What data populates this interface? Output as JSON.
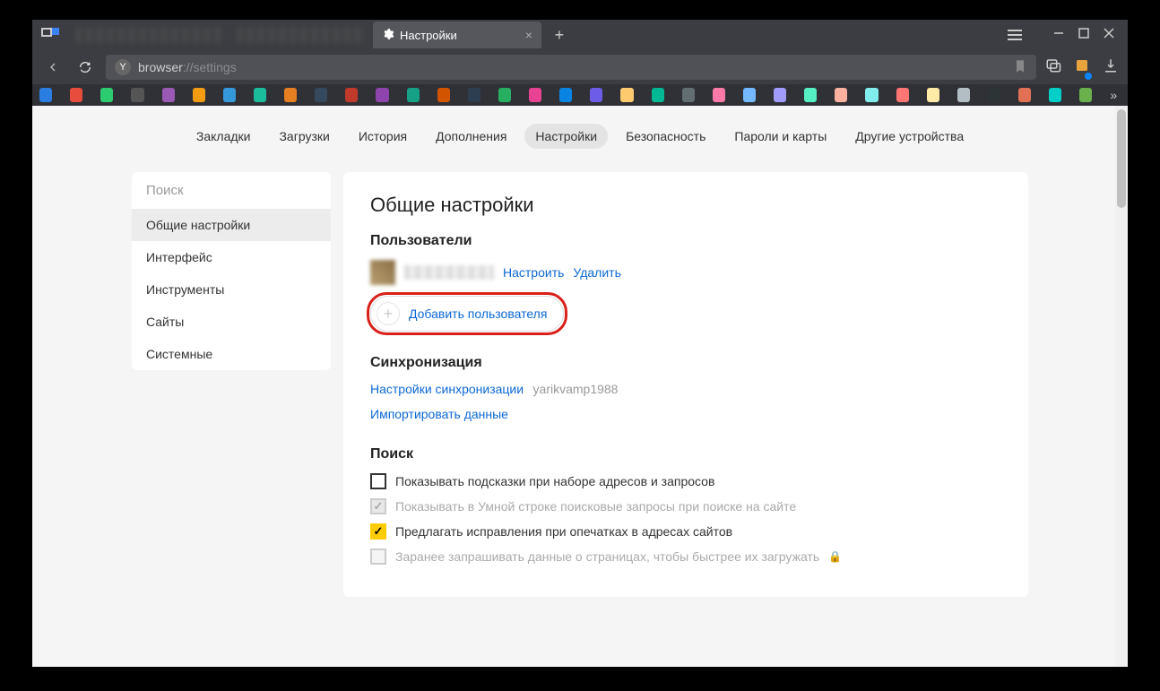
{
  "window": {
    "active_tab_title": "Настройки",
    "url_scheme": "browser",
    "url_path": "://settings"
  },
  "topnav": {
    "items": [
      "Закладки",
      "Загрузки",
      "История",
      "Дополнения",
      "Настройки",
      "Безопасность",
      "Пароли и карты",
      "Другие устройства"
    ],
    "active_index": 4
  },
  "sidebar": {
    "search_placeholder": "Поиск",
    "items": [
      "Общие настройки",
      "Интерфейс",
      "Инструменты",
      "Сайты",
      "Системные"
    ],
    "active_index": 0
  },
  "main": {
    "title": "Общие настройки",
    "users": {
      "heading": "Пользователи",
      "configure": "Настроить",
      "delete": "Удалить",
      "add_user": "Добавить пользователя"
    },
    "sync": {
      "heading": "Синхронизация",
      "settings_link": "Настройки синхронизации",
      "username": "yarikvamp1988",
      "import_link": "Импортировать данные"
    },
    "search": {
      "heading": "Поиск",
      "opt_suggestions": "Показывать подсказки при наборе адресов и запросов",
      "opt_smartline": "Показывать в Умной строке поисковые запросы при поиске на сайте",
      "opt_typo": "Предлагать исправления при опечатках в адресах сайтов",
      "opt_prefetch": "Заранее запрашивать данные о страницах, чтобы быстрее их загружать"
    }
  },
  "bookmark_colors": [
    "#2a7de1",
    "#e74c3c",
    "#2ecc71",
    "#555",
    "#9b59b6",
    "#f39c12",
    "#3498db",
    "#1abc9c",
    "#e67e22",
    "#34495e",
    "#c0392b",
    "#8e44ad",
    "#16a085",
    "#d35400",
    "#2c3e50",
    "#27ae60",
    "#e84393",
    "#0984e3",
    "#6c5ce7",
    "#fdcb6e",
    "#00b894",
    "#636e72",
    "#fd79a8",
    "#74b9ff",
    "#a29bfe",
    "#55efc4",
    "#fab1a0",
    "#81ecec",
    "#ff7675",
    "#ffeaa7",
    "#b2bec3",
    "#2d3436",
    "#e17055",
    "#00cec9",
    "#6ab04c"
  ]
}
